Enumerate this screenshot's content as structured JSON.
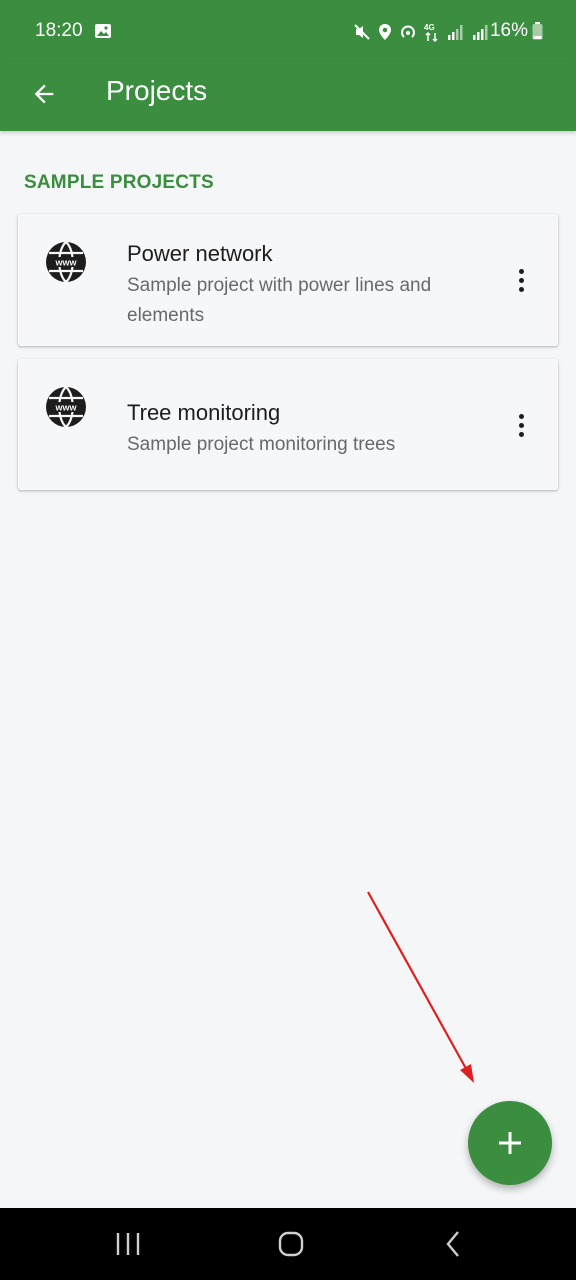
{
  "status_bar": {
    "time": "18:20",
    "battery": "16%",
    "icons": [
      "gallery-icon",
      "mute-icon",
      "location-icon",
      "hotspot-icon",
      "network-4g-icon",
      "signal-icon",
      "signal-icon",
      "battery-icon"
    ]
  },
  "app_bar": {
    "title": "Projects",
    "back_icon": "arrow-back-icon"
  },
  "section": {
    "header": "SAMPLE PROJECTS"
  },
  "projects": [
    {
      "title": "Power network",
      "description": "Sample project with power lines and elements",
      "icon": "globe-www-icon"
    },
    {
      "title": "Tree monitoring",
      "description": "Sample project monitoring trees",
      "icon": "globe-www-icon"
    }
  ],
  "fab": {
    "icon": "plus-icon"
  },
  "colors": {
    "primary": "#3b8e3f",
    "background": "#f5f6f8",
    "annotation_arrow": "#e02020"
  },
  "nav_bar": {
    "buttons": [
      "recents-icon",
      "home-icon",
      "back-icon"
    ]
  }
}
